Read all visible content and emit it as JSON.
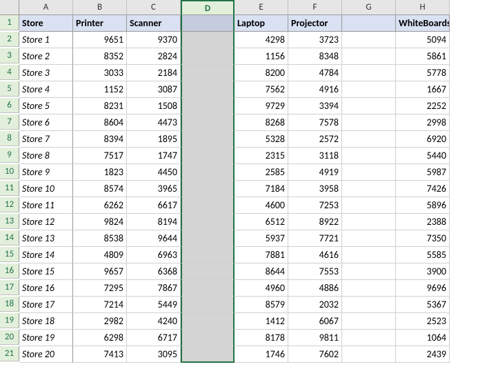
{
  "col_headers": [
    "A",
    "B",
    "C",
    "D",
    "E",
    "F",
    "G",
    "H"
  ],
  "row_headers": [
    "1",
    "2",
    "3",
    "4",
    "5",
    "6",
    "7",
    "8",
    "9",
    "10",
    "11",
    "12",
    "13",
    "14",
    "15",
    "16",
    "17",
    "18",
    "19",
    "20",
    "21"
  ],
  "selected_col": "D",
  "header_row": {
    "A": "Store",
    "B": "Printer",
    "C": "Scanner",
    "D": "",
    "E": "Laptop",
    "F": "Projector",
    "G": "",
    "H": "WhiteBoards"
  },
  "rows": [
    {
      "A": "Store 1",
      "B": "9651",
      "C": "9370",
      "D": "",
      "E": "4298",
      "F": "3723",
      "G": "",
      "H": "5094"
    },
    {
      "A": "Store 2",
      "B": "8352",
      "C": "2824",
      "D": "",
      "E": "1156",
      "F": "8348",
      "G": "",
      "H": "5861"
    },
    {
      "A": "Store 3",
      "B": "3033",
      "C": "2184",
      "D": "",
      "E": "8200",
      "F": "4784",
      "G": "",
      "H": "5778"
    },
    {
      "A": "Store 4",
      "B": "1152",
      "C": "3087",
      "D": "",
      "E": "7562",
      "F": "4916",
      "G": "",
      "H": "1667"
    },
    {
      "A": "Store 5",
      "B": "8231",
      "C": "1508",
      "D": "",
      "E": "9729",
      "F": "3394",
      "G": "",
      "H": "2252"
    },
    {
      "A": "Store 6",
      "B": "8604",
      "C": "4473",
      "D": "",
      "E": "8268",
      "F": "7578",
      "G": "",
      "H": "2998"
    },
    {
      "A": "Store 7",
      "B": "8394",
      "C": "1895",
      "D": "",
      "E": "5328",
      "F": "2572",
      "G": "",
      "H": "6920"
    },
    {
      "A": "Store 8",
      "B": "7517",
      "C": "1747",
      "D": "",
      "E": "2315",
      "F": "3118",
      "G": "",
      "H": "5440"
    },
    {
      "A": "Store 9",
      "B": "1823",
      "C": "4450",
      "D": "",
      "E": "2585",
      "F": "4919",
      "G": "",
      "H": "5987"
    },
    {
      "A": "Store 10",
      "B": "8574",
      "C": "3965",
      "D": "",
      "E": "7184",
      "F": "3958",
      "G": "",
      "H": "7426"
    },
    {
      "A": "Store 11",
      "B": "6262",
      "C": "6617",
      "D": "",
      "E": "4600",
      "F": "7253",
      "G": "",
      "H": "5896"
    },
    {
      "A": "Store 12",
      "B": "9824",
      "C": "8194",
      "D": "",
      "E": "6512",
      "F": "8922",
      "G": "",
      "H": "2388"
    },
    {
      "A": "Store 13",
      "B": "8538",
      "C": "9644",
      "D": "",
      "E": "5937",
      "F": "7721",
      "G": "",
      "H": "7350"
    },
    {
      "A": "Store 14",
      "B": "4809",
      "C": "6963",
      "D": "",
      "E": "7881",
      "F": "4616",
      "G": "",
      "H": "5585"
    },
    {
      "A": "Store 15",
      "B": "9657",
      "C": "6368",
      "D": "",
      "E": "8644",
      "F": "7553",
      "G": "",
      "H": "3900"
    },
    {
      "A": "Store 16",
      "B": "7295",
      "C": "7867",
      "D": "",
      "E": "4960",
      "F": "4886",
      "G": "",
      "H": "9696"
    },
    {
      "A": "Store 17",
      "B": "7214",
      "C": "5449",
      "D": "",
      "E": "8579",
      "F": "2032",
      "G": "",
      "H": "5367"
    },
    {
      "A": "Store 18",
      "B": "2982",
      "C": "4240",
      "D": "",
      "E": "1412",
      "F": "6067",
      "G": "",
      "H": "2523"
    },
    {
      "A": "Store 19",
      "B": "6298",
      "C": "6717",
      "D": "",
      "E": "8178",
      "F": "9811",
      "G": "",
      "H": "1064"
    },
    {
      "A": "Store 20",
      "B": "7413",
      "C": "3095",
      "D": "",
      "E": "1746",
      "F": "7602",
      "G": "",
      "H": "2439"
    }
  ]
}
